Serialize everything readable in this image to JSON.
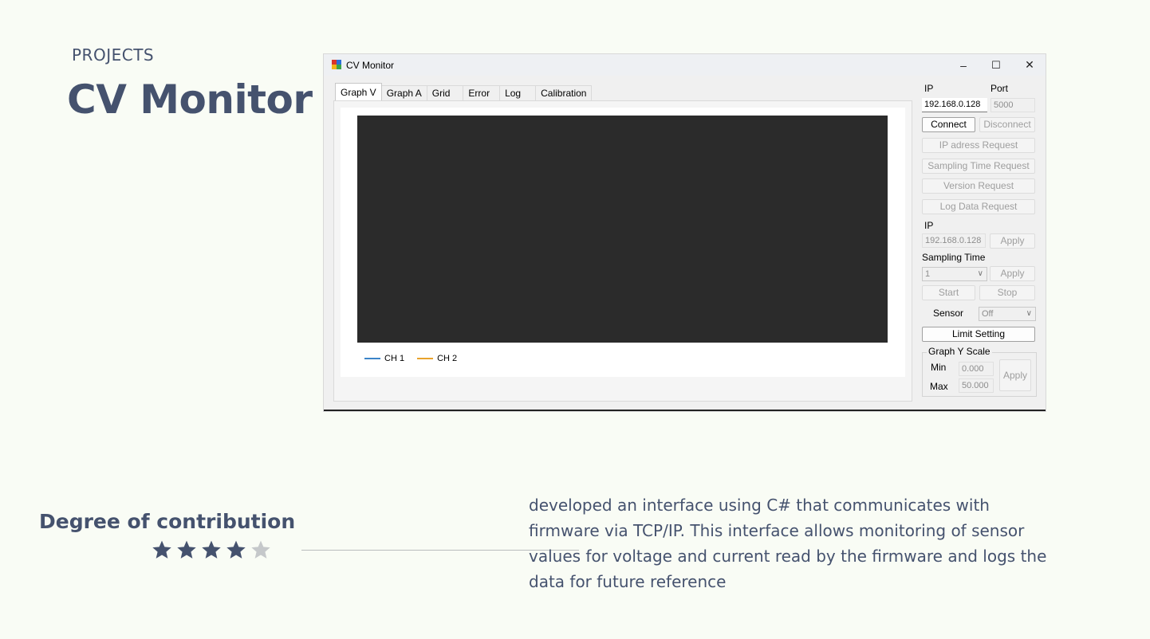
{
  "slide": {
    "eyebrow": "PROJECTS",
    "title": "CV Monitor",
    "contribution_label": "Degree of contribution",
    "rating": {
      "value": 4,
      "max": 5
    },
    "description": "developed an interface using C# that communicates with firmware via TCP/IP. This interface allows monitoring of sensor values for voltage and current read by the firmware and logs the data for future reference"
  },
  "window": {
    "title": "CV Monitor",
    "controls": {
      "minimize": "–",
      "maximize": "☐",
      "close": "✕"
    },
    "tabs": [
      "Graph V",
      "Graph A",
      "Grid",
      "Error",
      "Log",
      "Calibration"
    ],
    "active_tab": 0,
    "legend": [
      {
        "label": "CH 1",
        "color": "#3b84c8"
      },
      {
        "label": "CH 2",
        "color": "#e8a32c"
      }
    ],
    "panel": {
      "ip_label": "IP",
      "port_label": "Port",
      "ip_value": "192.168.0.128",
      "port_value": "5000",
      "connect": "Connect",
      "disconnect": "Disconnect",
      "ip_request": "IP adress Request",
      "sampling_request": "Sampling Time Request",
      "version_request": "Version Request",
      "log_request": "Log Data Request",
      "ip_label2": "IP",
      "ip_value2": "192.168.0.128",
      "apply": "Apply",
      "sampling_label": "Sampling Time",
      "sampling_value": "1",
      "start": "Start",
      "stop": "Stop",
      "sensor_label": "Sensor",
      "sensor_value": "Off",
      "limit_setting": "Limit Setting",
      "yscale_title": "Graph Y Scale",
      "min_label": "Min",
      "max_label": "Max",
      "min_value": "0.000",
      "max_value": "50.000"
    }
  },
  "colors": {
    "accent": "#45526e",
    "background": "#f9fcf5",
    "star_on": "#45526e",
    "star_off": "#c5c8ca"
  }
}
